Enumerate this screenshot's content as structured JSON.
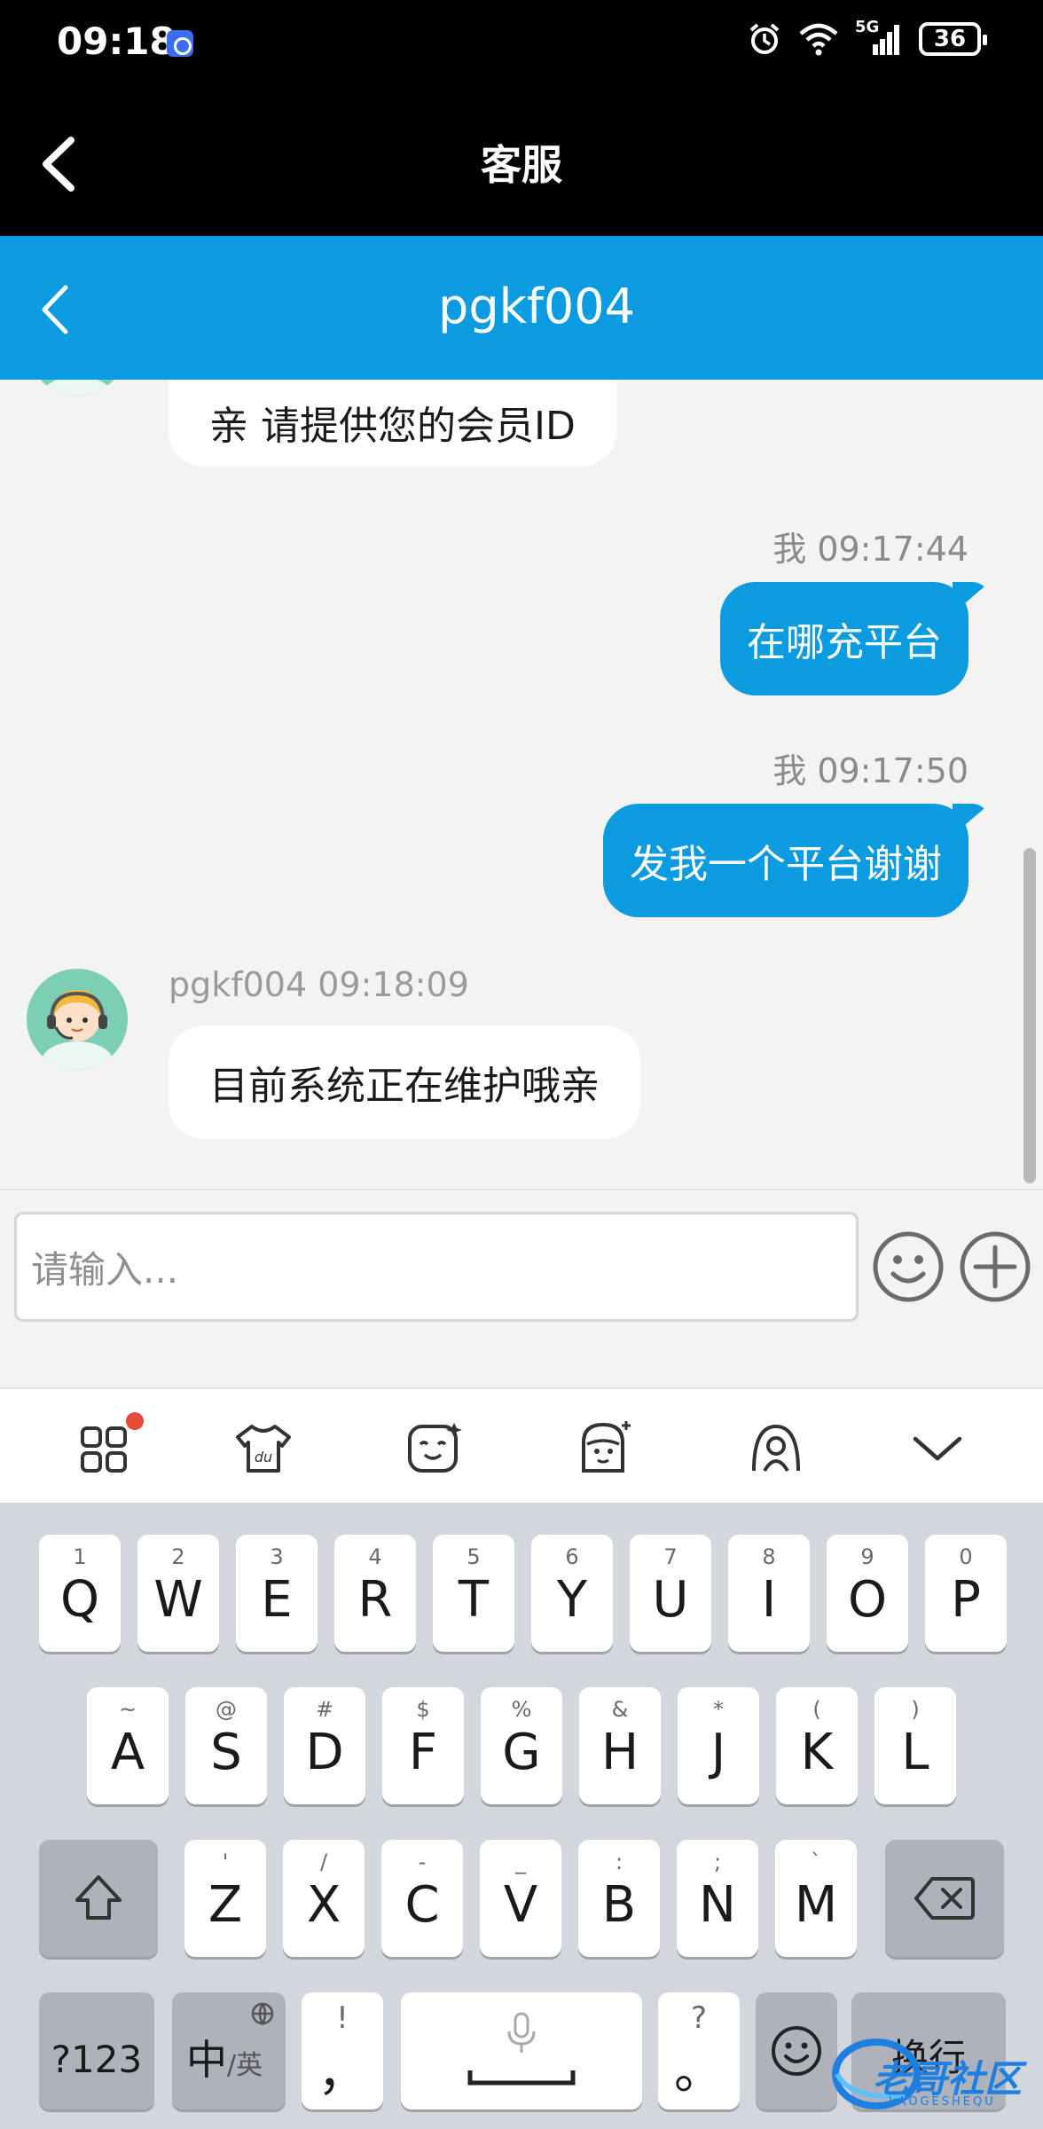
{
  "status_bar": {
    "time": "09:18",
    "network": "5G",
    "battery": "36"
  },
  "title_bar": {
    "title": "客服"
  },
  "chat_header": {
    "title": "pgkf004"
  },
  "messages": [
    {
      "side": "left",
      "text": "亲 请提供您的会员ID"
    },
    {
      "side": "right",
      "meta": "我 09:17:44",
      "text": "在哪充平台"
    },
    {
      "side": "right",
      "meta": "我 09:17:50",
      "text": "发我一个平台谢谢"
    },
    {
      "side": "left",
      "meta": "pgkf004 09:18:09",
      "text": "目前系统正在维护哦亲"
    }
  ],
  "input": {
    "placeholder": "请输入..."
  },
  "keyboard": {
    "row1": [
      {
        "main": "Q",
        "sub": "1"
      },
      {
        "main": "W",
        "sub": "2"
      },
      {
        "main": "E",
        "sub": "3"
      },
      {
        "main": "R",
        "sub": "4"
      },
      {
        "main": "T",
        "sub": "5"
      },
      {
        "main": "Y",
        "sub": "6"
      },
      {
        "main": "U",
        "sub": "7"
      },
      {
        "main": "I",
        "sub": "8"
      },
      {
        "main": "O",
        "sub": "9"
      },
      {
        "main": "P",
        "sub": "0"
      }
    ],
    "row2": [
      {
        "main": "A",
        "sub": "~"
      },
      {
        "main": "S",
        "sub": "@"
      },
      {
        "main": "D",
        "sub": "#"
      },
      {
        "main": "F",
        "sub": "$"
      },
      {
        "main": "G",
        "sub": "%"
      },
      {
        "main": "H",
        "sub": "&"
      },
      {
        "main": "J",
        "sub": "*"
      },
      {
        "main": "K",
        "sub": "("
      },
      {
        "main": "L",
        "sub": ")"
      }
    ],
    "row3": [
      {
        "main": "Z",
        "sub": "'"
      },
      {
        "main": "X",
        "sub": "/"
      },
      {
        "main": "C",
        "sub": "-"
      },
      {
        "main": "V",
        "sub": "_"
      },
      {
        "main": "B",
        "sub": ":"
      },
      {
        "main": "N",
        "sub": ";"
      },
      {
        "main": "M",
        "sub": "`"
      }
    ],
    "symbols_key": "?123",
    "lang_key_main": "中",
    "lang_key_sub": "/英",
    "punct_key_main": "，",
    "punct_key_sub": "!",
    "period_key_main": "。",
    "period_key_sub": "?",
    "enter_key": "换行"
  },
  "watermark": {
    "text": "老哥社区",
    "sub": "LAOGESHEQU"
  }
}
